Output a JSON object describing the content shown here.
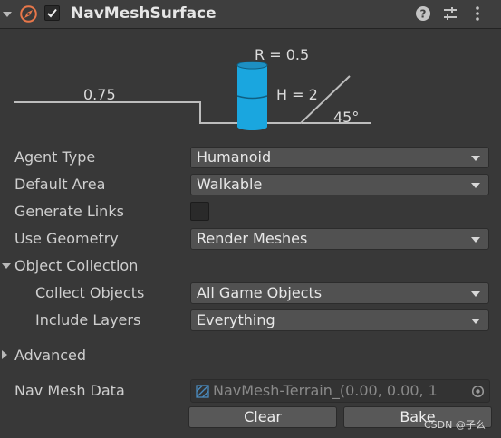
{
  "component": {
    "title": "NavMeshSurface",
    "enabled": true,
    "icons": [
      "compass-icon",
      "help-icon",
      "preset-icon",
      "more-icon"
    ]
  },
  "diagram": {
    "step_height": "0.75",
    "radius": "R = 0.5",
    "height": "H = 2",
    "slope": "45°",
    "agent_color": "#1aa6df"
  },
  "fields": {
    "agent_type": {
      "label": "Agent Type",
      "value": "Humanoid"
    },
    "default_area": {
      "label": "Default Area",
      "value": "Walkable"
    },
    "generate_links": {
      "label": "Generate Links",
      "checked": false
    },
    "use_geometry": {
      "label": "Use Geometry",
      "value": "Render Meshes"
    },
    "object_collection": {
      "label": "Object Collection",
      "expanded": true
    },
    "collect_objects": {
      "label": "Collect Objects",
      "value": "All Game Objects"
    },
    "include_layers": {
      "label": "Include Layers",
      "value": "Everything"
    },
    "advanced": {
      "label": "Advanced",
      "expanded": false
    },
    "nav_mesh_data": {
      "label": "Nav Mesh Data",
      "value": "NavMesh-Terrain_(0.00, 0.00, 1"
    }
  },
  "buttons": {
    "clear": "Clear",
    "bake": "Bake"
  },
  "watermark": "CSDN @子么"
}
